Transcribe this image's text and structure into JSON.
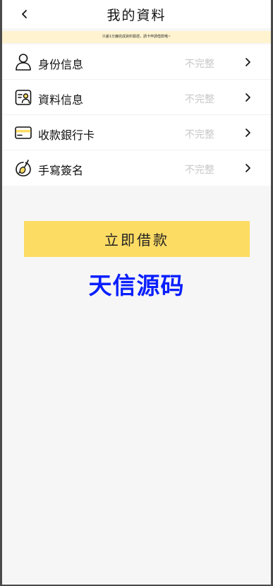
{
  "header": {
    "title": "我的資料",
    "back_icon": "chevron-left-icon"
  },
  "notice": {
    "text": "只差1分鐘完成資料驗證，請卡申請借款哦~"
  },
  "items": [
    {
      "label": "身份信息",
      "status": "不完整",
      "icon": "user-icon"
    },
    {
      "label": "資料信息",
      "status": "不完整",
      "icon": "profile-card-icon"
    },
    {
      "label": "收款銀行卡",
      "status": "不完整",
      "icon": "bank-card-icon"
    },
    {
      "label": "手寫簽名",
      "status": "不完整",
      "icon": "signature-icon"
    }
  ],
  "cta": {
    "label": "立即借款"
  },
  "watermark": {
    "text": "天信源码"
  },
  "colors": {
    "accent": "#fddc64",
    "notice_bg": "#fff4cf",
    "status_text": "#c8c8c8",
    "watermark": "#0a1fff"
  }
}
